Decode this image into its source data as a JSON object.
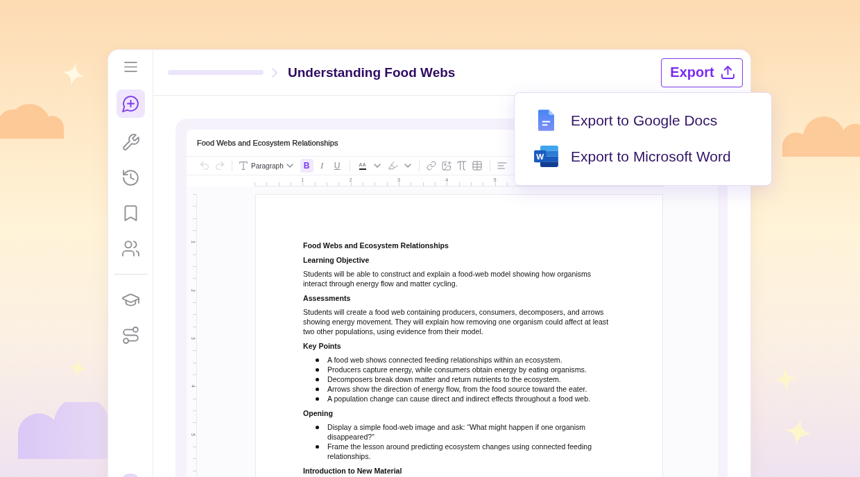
{
  "sidebar": {
    "items": [
      {
        "selected": true
      },
      {
        "selected": false
      },
      {
        "selected": false
      },
      {
        "selected": false
      },
      {
        "selected": false
      }
    ],
    "section_items": [
      {
        "selected": false
      },
      {
        "selected": false
      }
    ]
  },
  "header": {
    "title": "Understanding Food Webs",
    "export_button": "Export"
  },
  "export_menu": {
    "items": [
      {
        "label": "Export to Google Docs"
      },
      {
        "label": "Export to Microsoft Word",
        "icon_letter": "W"
      }
    ]
  },
  "editor": {
    "title": "Food Webs and Ecosystem Relationships",
    "toolbar": {
      "undo": {
        "disabled": true
      },
      "redo": {
        "disabled": true
      },
      "block_style": "Paragraph",
      "formats": [
        {
          "kind": "bold",
          "label": "B",
          "selected": true
        },
        {
          "kind": "italic",
          "label": "I",
          "selected": false
        },
        {
          "kind": "underline",
          "label": "U",
          "selected": false
        }
      ],
      "text_color_label": "AA"
    },
    "ruler": [
      "1",
      "2",
      "3",
      "4",
      "5"
    ],
    "side_ruler": [
      "1",
      "2",
      "3",
      "4",
      "5"
    ],
    "document": [
      {
        "kind": "heading",
        "text": "Food Webs and Ecosystem Relationships"
      },
      {
        "kind": "heading",
        "text": "Learning Objective"
      },
      {
        "kind": "paragraph",
        "text": "Students will be able to construct and explain a food-web model showing how organisms interact through energy flow and matter cycling."
      },
      {
        "kind": "heading",
        "text": "Assessments"
      },
      {
        "kind": "paragraph",
        "text": "Students will create a food web containing producers, consumers, decomposers, and arrows showing energy movement. They will explain how removing one organism could affect at least two other populations, using evidence from their model."
      },
      {
        "kind": "heading",
        "text": "Key Points"
      },
      {
        "kind": "list",
        "items": [
          "A food web shows connected feeding relationships within an ecosystem.",
          "Producers capture energy, while consumers obtain energy by eating organisms.",
          "Decomposers break down matter and return nutrients to the ecosystem.",
          "Arrows show the direction of energy flow, from the food source toward the eater.",
          "A population change can cause direct and indirect effects throughout a food web."
        ]
      },
      {
        "kind": "heading",
        "text": "Opening"
      },
      {
        "kind": "list",
        "items": [
          "Display a simple food-web image and ask: “What might happen if one organism disappeared?”",
          "Frame the lesson around predicting ecosystem changes using connected feeding relationships."
        ]
      },
      {
        "kind": "heading",
        "text": "Introduction to New Material"
      }
    ]
  }
}
